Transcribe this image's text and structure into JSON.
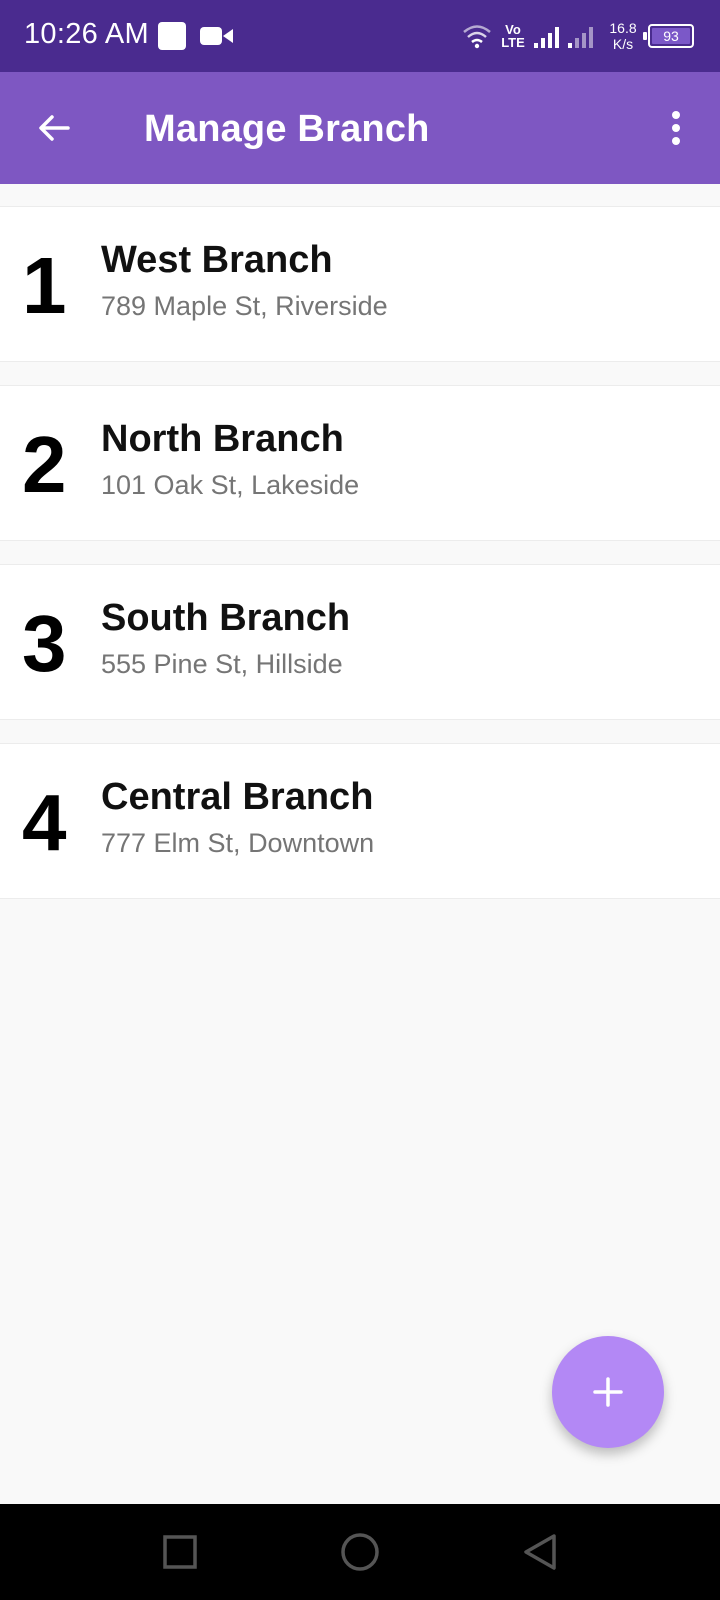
{
  "status_bar": {
    "time": "10:26 AM",
    "network_type_top": "Vo",
    "network_type_bottom": "LTE",
    "speed_value": "16.8",
    "speed_unit": "K/s",
    "battery_level": "93",
    "icons": [
      "square-notification-icon",
      "video-icon",
      "wifi-icon",
      "signal-icon",
      "battery-icon"
    ]
  },
  "app_bar": {
    "title": "Manage Branch",
    "background": "#7e57c2",
    "icons": [
      "back-arrow-icon",
      "more-vert-icon"
    ]
  },
  "branches": [
    {
      "number": "1",
      "name": "West Branch",
      "address": "789 Maple St, Riverside"
    },
    {
      "number": "2",
      "name": "North Branch",
      "address": "101 Oak St, Lakeside"
    },
    {
      "number": "3",
      "name": "South Branch",
      "address": "555 Pine St, Hillside"
    },
    {
      "number": "4",
      "name": "Central Branch",
      "address": "777 Elm St, Downtown"
    }
  ],
  "fab": {
    "icon": "plus-icon",
    "color": "#b388f5"
  },
  "nav_bar": {
    "icons": [
      "recents-square-icon",
      "home-circle-icon",
      "back-triangle-icon"
    ]
  },
  "colors": {
    "status_bar": "#4a2b8f",
    "accent": "#7e57c2",
    "secondary_text": "#757575"
  }
}
